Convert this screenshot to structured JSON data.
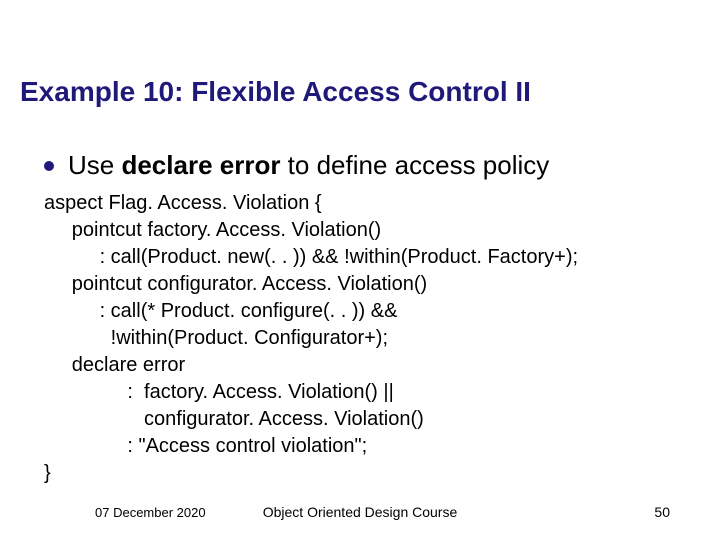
{
  "title": "Example 10: Flexible Access Control II",
  "bullet": {
    "prefix": "Use ",
    "bold": "declare error",
    "suffix": " to define access policy"
  },
  "code": {
    "l1": "aspect Flag. Access. Violation {",
    "l2": "     pointcut factory. Access. Violation()",
    "l3": "          : call(Product. new(. . )) && !within(Product. Factory+);",
    "l4": "     pointcut configurator. Access. Violation()",
    "l5": "          : call(* Product. configure(. . )) &&",
    "l6": "            !within(Product. Configurator+);",
    "l7": "     declare error",
    "l8": "               :  factory. Access. Violation() ||",
    "l9": "                  configurator. Access. Violation()",
    "l10": "               : \"Access control violation\";",
    "l11": "}"
  },
  "footer": {
    "date": "07 December 2020",
    "course": "Object Oriented Design Course",
    "page": "50"
  }
}
